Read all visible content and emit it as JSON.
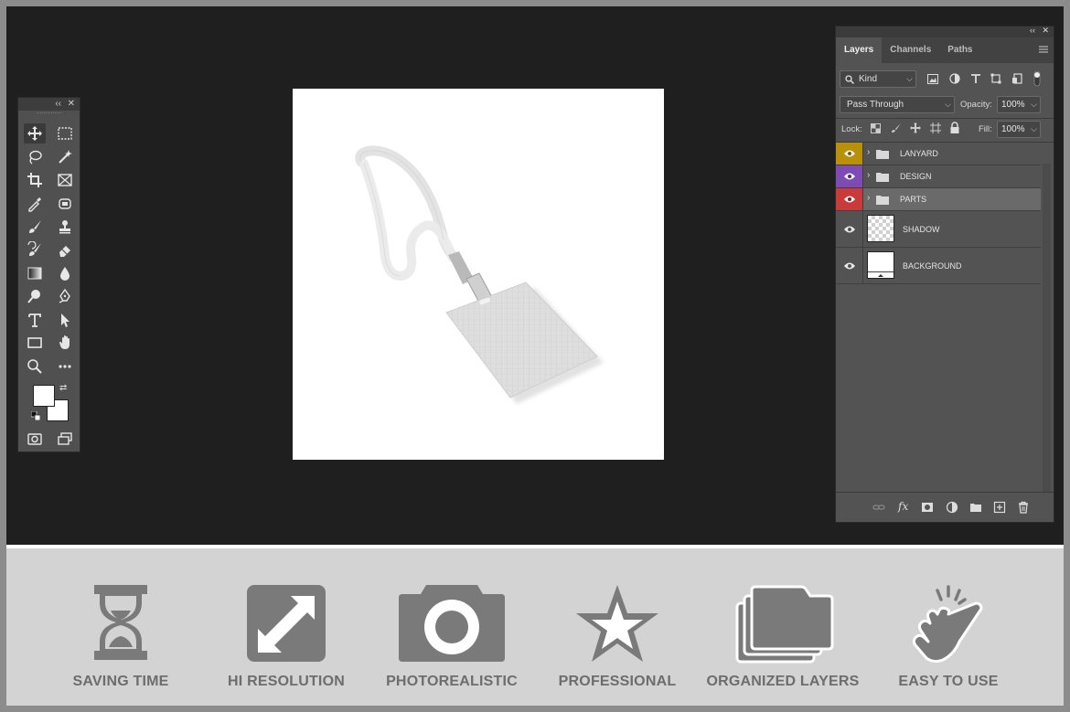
{
  "panel": {
    "tabs": [
      "Layers",
      "Channels",
      "Paths"
    ],
    "filter_kind": "Kind",
    "blend_mode": "Pass Through",
    "opacity_label": "Opacity:",
    "opacity_value": "100%",
    "lock_label": "Lock:",
    "fill_label": "Fill:",
    "fill_value": "100%",
    "layers": [
      {
        "name": "LANYARD",
        "type": "group",
        "color": "#b8900a"
      },
      {
        "name": "DESIGN",
        "type": "group",
        "color": "#7d4bb3"
      },
      {
        "name": "PARTS",
        "type": "group",
        "color": "#c93a3a",
        "selected": true
      },
      {
        "name": "SHADOW",
        "type": "layer",
        "thumb": "transparent"
      },
      {
        "name": "BACKGROUND",
        "type": "layer",
        "thumb": "white"
      }
    ]
  },
  "toolbox": {
    "tools": [
      "move-tool",
      "marquee-tool",
      "lasso-tool",
      "magic-wand-tool",
      "crop-tool",
      "frame-tool",
      "eyedropper-tool",
      "patch-tool",
      "brush-tool",
      "stamp-tool",
      "history-brush-tool",
      "eraser-tool",
      "gradient-tool",
      "blur-tool",
      "dodge-tool",
      "pen-tool",
      "type-tool",
      "path-select-tool",
      "rectangle-tool",
      "hand-rotate-tool",
      "zoom-tool",
      "more-tool",
      "quick-mask",
      "screen-mode"
    ]
  },
  "features": [
    {
      "label": "SAVING TIME",
      "icon": "hourglass-icon"
    },
    {
      "label": "HI RESOLUTION",
      "icon": "expand-arrows-icon"
    },
    {
      "label": "PHOTOREALISTIC",
      "icon": "camera-icon"
    },
    {
      "label": "PROFESSIONAL",
      "icon": "star-icon"
    },
    {
      "label": "ORGANIZED LAYERS",
      "icon": "stacked-folders-icon"
    },
    {
      "label": "EASY TO USE",
      "icon": "tap-hand-icon"
    }
  ],
  "colors": {
    "workspace": "#1f1f1f",
    "panel": "#535353",
    "feature_bar": "#d3d3d3",
    "feature_icon": "#7a7a7a"
  }
}
